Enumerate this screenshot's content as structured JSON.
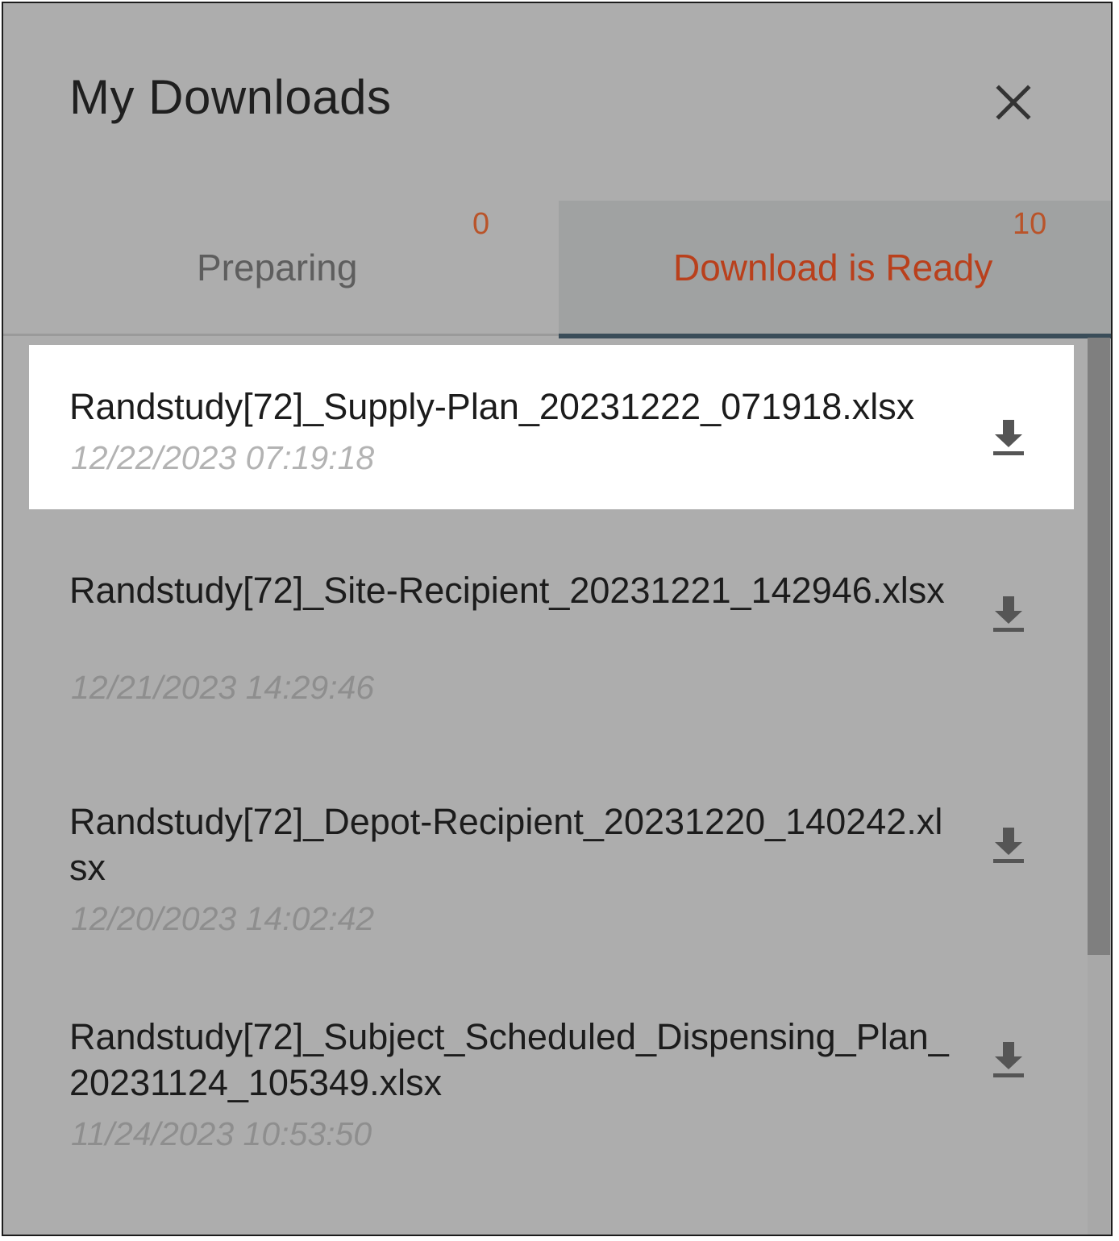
{
  "header": {
    "title": "My Downloads",
    "close_icon": "close-icon"
  },
  "tabs": [
    {
      "label": "Preparing",
      "count": "0",
      "active": false
    },
    {
      "label": "Download is Ready",
      "count": "10",
      "active": true
    }
  ],
  "items": [
    {
      "name": "Randstudy[72]_Supply-Plan_20231222_071918.xlsx",
      "date": "12/22/2023 07:19:18",
      "highlighted": true,
      "icon": "download-icon"
    },
    {
      "name": "Randstudy[72]_Site-Recipient_20231221_142946.xlsx",
      "date": "12/21/2023 14:29:46",
      "highlighted": false,
      "icon": "download-icon"
    },
    {
      "name": "Randstudy[72]_Depot-Recipient_20231220_140242.xlsx",
      "date": "12/20/2023 14:02:42",
      "highlighted": false,
      "icon": "download-icon"
    },
    {
      "name": "Randstudy[72]_Subject_Scheduled_Dispensing_Plan_20231124_105349.xlsx",
      "date": "11/24/2023 10:53:50",
      "highlighted": false,
      "icon": "download-icon"
    }
  ],
  "colors": {
    "active_tab_text": "#b9401c",
    "count": "#b9542a",
    "tab_underline": "#3a4d59",
    "panel_bg": "#adadad"
  }
}
